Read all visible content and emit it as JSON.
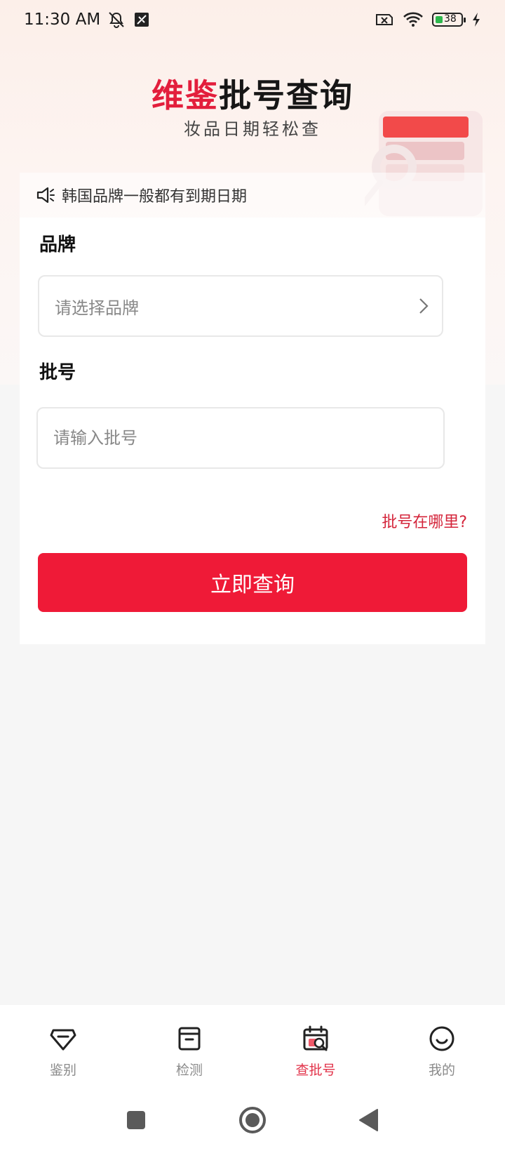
{
  "status_bar": {
    "time": "11:30 AM",
    "icons": [
      "mute-icon",
      "no-sim-icon",
      "sim-error-icon",
      "wifi-icon",
      "battery-icon",
      "charging-icon"
    ],
    "battery_level": "38"
  },
  "hero": {
    "title_accent": "维鉴",
    "title_main": "批号查询",
    "subtitle": "妆品日期轻松查"
  },
  "notice": {
    "icon": "speaker-icon",
    "text": "韩国品牌一般都有到期日期"
  },
  "form": {
    "brand_label": "品牌",
    "brand_placeholder": "请选择品牌",
    "batch_label": "批号",
    "batch_placeholder": "请输入批号",
    "help_link": "批号在哪里?",
    "submit_label": "立即查询"
  },
  "tabbar": {
    "tabs": [
      {
        "label": "鉴别",
        "icon": "diamond-icon",
        "active": false
      },
      {
        "label": "检测",
        "icon": "archive-box-icon",
        "active": false
      },
      {
        "label": "查批号",
        "icon": "calendar-search-icon",
        "active": true
      },
      {
        "label": "我的",
        "icon": "smiley-icon",
        "active": false
      }
    ]
  },
  "colors": {
    "accent": "#ef1a37",
    "accent_text": "#e2334a",
    "background": "#f6f6f6"
  }
}
